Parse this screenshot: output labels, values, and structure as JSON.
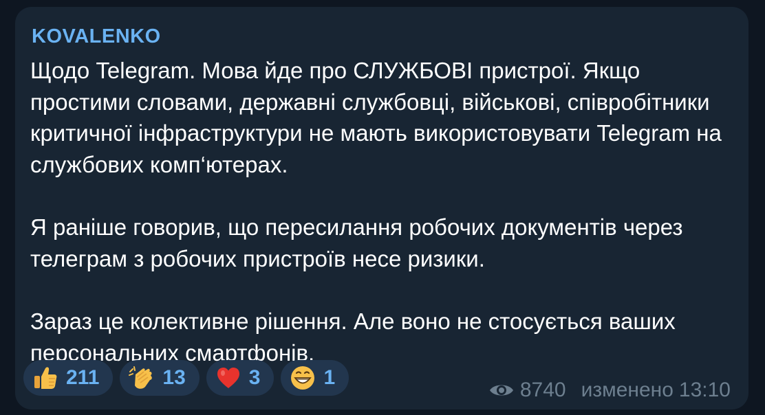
{
  "message": {
    "sender": "KOVALENKO",
    "paragraphs": [
      "Щодо Telegram. Мова йде про СЛУЖБОВІ пристрої. Якщо простими словами, державні службовці, військові, співробітники критичної інфраструктури не мають використовувати Telegram на службових комп‘ютерах.",
      "Я раніше говорив, що пересилання робочих документів через телеграм з робочих пристроїв несе ризики.",
      "Зараз це колективне рішення. Але воно не стосується ваших персональних смартфонів."
    ]
  },
  "reactions": [
    {
      "icon": "thumbs-up-icon",
      "count": "211"
    },
    {
      "icon": "clapping-hands-icon",
      "count": "13"
    },
    {
      "icon": "red-heart-icon",
      "count": "3"
    },
    {
      "icon": "grinning-face-icon",
      "count": "1"
    }
  ],
  "meta": {
    "views": "8740",
    "edited_label": "изменено",
    "time": "13:10"
  },
  "colors": {
    "background": "#0e1621",
    "bubble": "#182533",
    "sender": "#6ab2f2",
    "reaction_bg": "#22364e",
    "reaction_count": "#6ab2f2",
    "meta": "#6d7f8f"
  }
}
